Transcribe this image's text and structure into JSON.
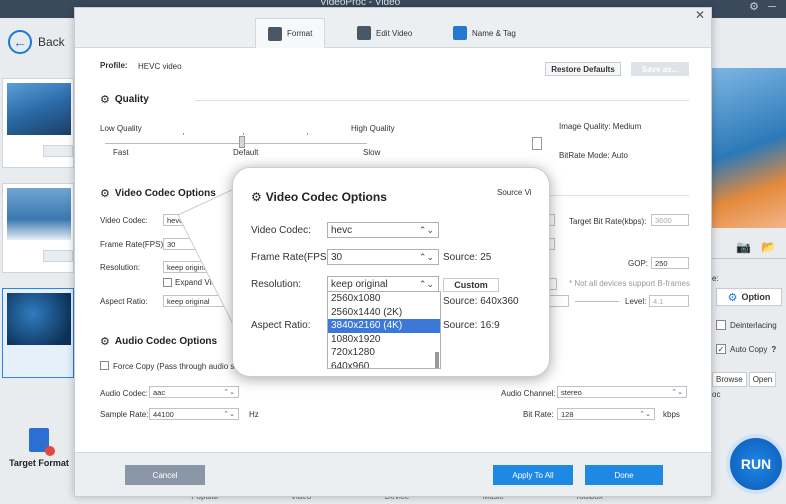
{
  "app": {
    "title": "VideoProc - Video",
    "back_label": "Back",
    "target_format_label": "Target Format",
    "run_label": "RUN"
  },
  "right_panel": {
    "e_label": "e:",
    "option_label": "Option",
    "deinterlacing_label": "Deinterlacing",
    "auto_copy_label": "Auto Copy",
    "auto_copy_help": "?",
    "browse_label": "Browse",
    "open_label": "Open",
    "oc_label": "oc"
  },
  "bottom_tabs": [
    "Popular",
    "Video",
    "Device",
    "Music",
    "Toolbox"
  ],
  "dialog": {
    "tabs": [
      {
        "label": "Format",
        "icon": "format-icon"
      },
      {
        "label": "Edit Video",
        "icon": "edit-video-icon"
      },
      {
        "label": "Name & Tag",
        "icon": "name-tag-icon"
      }
    ],
    "profile_label": "Profile:",
    "profile_value": "HEVC video",
    "restore_defaults": "Restore Defaults",
    "save_as": "Save as...",
    "quality": {
      "title": "Quality",
      "low": "Low Quality",
      "high": "High Quality",
      "fast": "Fast",
      "default": "Default",
      "slow": "Slow",
      "image_quality": "Image Quality: Medium",
      "bitrate_mode": "BitRate Mode: Auto"
    },
    "video_codec": {
      "title": "Video Codec Options",
      "source_vi": "Source Vi",
      "codec_label": "Video Codec:",
      "codec_value": "hevc",
      "frame_rate_label": "Frame Rate(FPS):",
      "frame_rate_value": "30",
      "resolution_label": "Resolution:",
      "resolution_value": "keep original",
      "expand_video": "Expand Video",
      "aspect_label": "Aspect Ratio:",
      "aspect_value": "keep original",
      "target_bit_rate_label": "Target Bit Rate(kbps):",
      "target_bit_rate_value": "3600",
      "gop_label": "GOP:",
      "gop_value": "250",
      "bframes_note": "* Not all devices support B-frames",
      "level_label": "Level:",
      "level_value": "4.1"
    },
    "audio_codec": {
      "title": "Audio Codec Options",
      "force_copy": "Force Copy (Pass through audio stre",
      "audio_codec_label": "Audio Codec:",
      "audio_codec_value": "aac",
      "sample_rate_label": "Sample Rate:",
      "sample_rate_value": "44100",
      "hz": "Hz",
      "audio_channel_label": "Audio Channel:",
      "audio_channel_value": "stereo",
      "bit_rate_label": "Bit Rate:",
      "bit_rate_value": "128",
      "kbps": "kbps"
    },
    "cancel": "Cancel",
    "apply_to_all": "Apply To All",
    "done": "Done"
  },
  "zoom": {
    "title": "Video Codec Options",
    "source_vi": "Source Vi",
    "codec_label": "Video Codec:",
    "codec_value": "hevc",
    "frame_rate_label": "Frame Rate(FPS):",
    "frame_rate_value": "30",
    "source_fps": "Source: 25",
    "resolution_label": "Resolution:",
    "resolution_value": "keep original",
    "custom": "Custom",
    "source_res": "Source: 640x360",
    "aspect_label": "Aspect Ratio:",
    "source_aspect": "Source: 16:9",
    "resolution_options": [
      "2560x1080",
      "2560x1440 (2K)",
      "3840x2160 (4K)",
      "1080x1920",
      "720x1280",
      "640x960"
    ],
    "selected_option": "3840x2160 (4K)"
  }
}
